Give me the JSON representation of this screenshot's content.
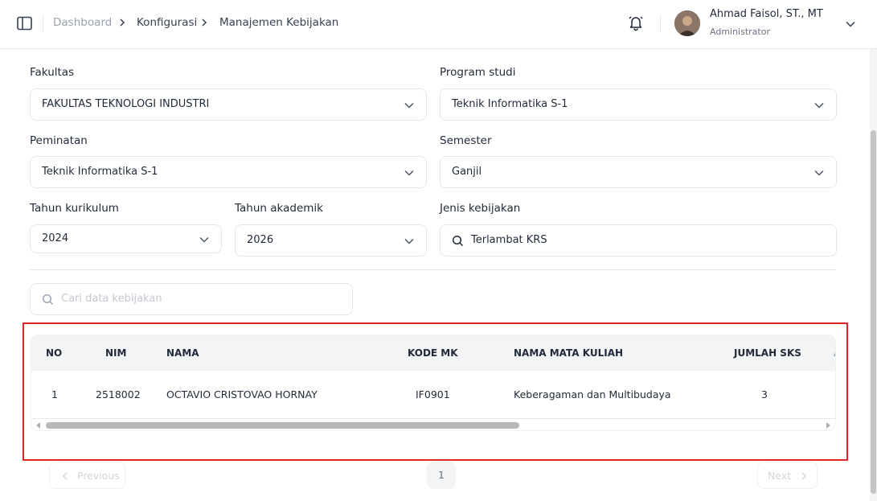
{
  "breadcrumb": {
    "items": [
      "Dashboard",
      "Konfigurasi",
      "Manajemen Kebijakan"
    ]
  },
  "user": {
    "name": "Ahmad Faisol, ST., MT",
    "role": "Administrator"
  },
  "filters": {
    "fakultas": {
      "label": "Fakultas",
      "value": "FAKULTAS TEKNOLOGI INDUSTRI"
    },
    "program_studi": {
      "label": "Program studi",
      "value": "Teknik Informatika S-1"
    },
    "peminatan": {
      "label": "Peminatan",
      "value": "Teknik Informatika S-1"
    },
    "semester": {
      "label": "Semester",
      "value": "Ganjil"
    },
    "tahun_kurikulum": {
      "label": "Tahun kurikulum",
      "value": "2024"
    },
    "tahun_akademik": {
      "label": "Tahun akademik",
      "value": "2026"
    },
    "jenis_kebijakan": {
      "label": "Jenis kebijakan",
      "value": "Terlambat KRS"
    }
  },
  "search": {
    "placeholder": "Cari data kebijakan"
  },
  "table": {
    "headers": [
      "NO",
      "NIM",
      "NAMA",
      "KODE MK",
      "NAMA MATA KULIAH",
      "JUMLAH SKS"
    ],
    "rows": [
      [
        "1",
        "2518002",
        "OCTAVIO CRISTOVAO HORNAY",
        "IF0901",
        "Keberagaman dan Multibudaya",
        "3"
      ]
    ]
  },
  "pagination": {
    "previous": "Previous",
    "current_page": "1",
    "next": "Next"
  },
  "colors": {
    "highlight_border": "#dc2626",
    "header_bg": "#f3f4f6"
  }
}
